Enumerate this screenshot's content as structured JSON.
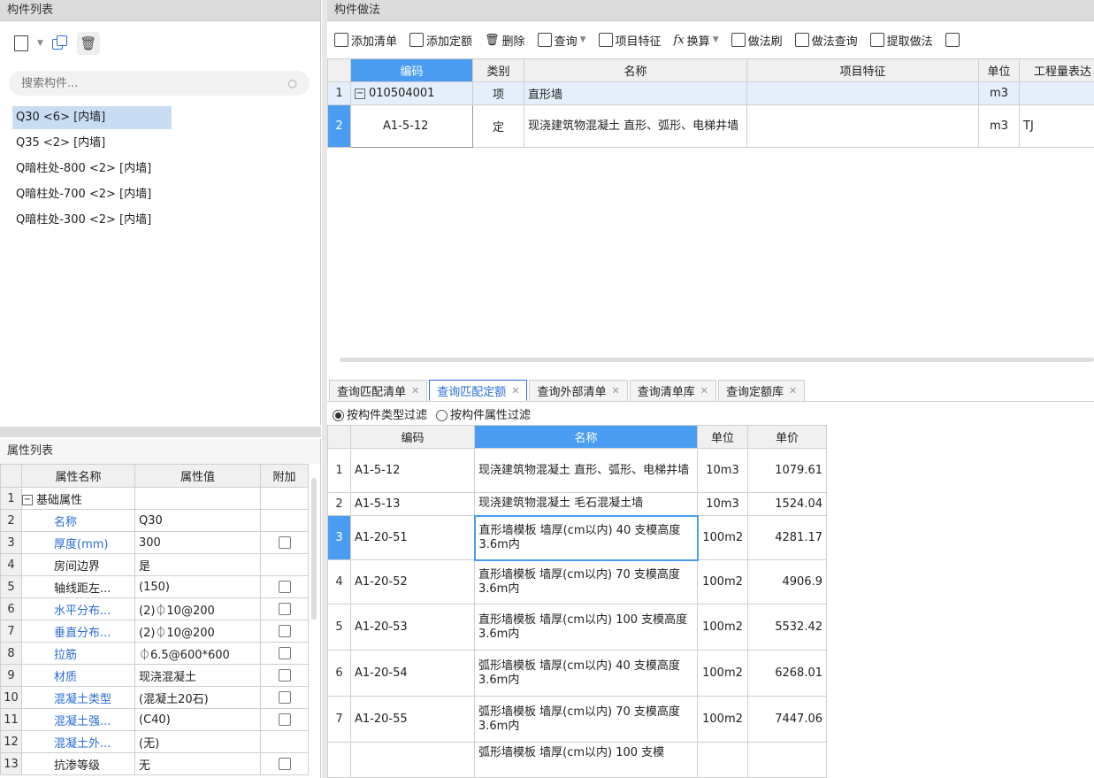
{
  "left_panel": {
    "title": "构件列表",
    "search_placeholder": "搜索构件...",
    "items": [
      {
        "label": "Q30 <6> [内墙]"
      },
      {
        "label": "Q35 <2> [内墙]"
      },
      {
        "label": "Q暗柱处-800 <2> [内墙]"
      },
      {
        "label": "Q暗柱处-700 <2> [内墙]"
      },
      {
        "label": "Q暗柱处-300 <2> [内墙]"
      }
    ]
  },
  "props_panel": {
    "title": "属性列表",
    "headers": {
      "name": "属性名称",
      "value": "属性值",
      "extra": "附加"
    },
    "rows": [
      {
        "n": "1",
        "name": "基础属性",
        "value": "",
        "cb": false,
        "blue": false,
        "group": true
      },
      {
        "n": "2",
        "name": "名称",
        "value": "Q30",
        "cb": false,
        "blue": true
      },
      {
        "n": "3",
        "name": "厚度(mm)",
        "value": "300",
        "cb": true,
        "blue": true
      },
      {
        "n": "4",
        "name": "房间边界",
        "value": "是",
        "cb": false,
        "blue": false
      },
      {
        "n": "5",
        "name": "轴线距左...",
        "value": "(150)",
        "cb": true,
        "blue": false
      },
      {
        "n": "6",
        "name": "水平分布...",
        "value": "(2)⏀10@200",
        "cb": true,
        "blue": true
      },
      {
        "n": "7",
        "name": "垂直分布...",
        "value": "(2)⏀10@200",
        "cb": true,
        "blue": true
      },
      {
        "n": "8",
        "name": "拉筋",
        "value": "⏀6.5@600*600",
        "cb": true,
        "blue": true
      },
      {
        "n": "9",
        "name": "材质",
        "value": "现浇混凝土",
        "cb": true,
        "blue": true
      },
      {
        "n": "10",
        "name": "混凝土类型",
        "value": "(混凝土20石)",
        "cb": true,
        "blue": true
      },
      {
        "n": "11",
        "name": "混凝土强...",
        "value": "(C40)",
        "cb": true,
        "blue": true
      },
      {
        "n": "12",
        "name": "混凝土外...",
        "value": "(无)",
        "cb": false,
        "blue": true
      },
      {
        "n": "13",
        "name": "抗渗等级",
        "value": "无",
        "cb": true,
        "blue": false
      }
    ]
  },
  "method_panel": {
    "title": "构件做法",
    "toolbar": [
      "添加清单",
      "添加定额",
      "删除",
      "查询",
      "项目特征",
      "换算",
      "做法刷",
      "做法查询",
      "提取做法"
    ],
    "headers": [
      "编码",
      "类别",
      "名称",
      "项目特征",
      "单位",
      "工程量表达"
    ],
    "rows": [
      {
        "n": "1",
        "code": "010504001",
        "type": "项",
        "name": "直形墙",
        "feature": "",
        "unit": "m3",
        "expr": ""
      },
      {
        "n": "2",
        "code": "A1-5-12",
        "type": "定",
        "name": "现浇建筑物混凝土 直形、弧形、电梯井墙",
        "feature": "",
        "unit": "m3",
        "expr": "TJ"
      }
    ]
  },
  "query_panel": {
    "tabs": [
      "查询匹配清单",
      "查询匹配定额",
      "查询外部清单",
      "查询清单库",
      "查询定额库"
    ],
    "filters": [
      "按构件类型过滤",
      "按构件属性过滤"
    ],
    "headers": [
      "编码",
      "名称",
      "单位",
      "单价"
    ],
    "rows": [
      {
        "n": "1",
        "code": "A1-5-12",
        "name": "现浇建筑物混凝土 直形、弧形、电梯井墙",
        "unit": "10m3",
        "price": "1079.61"
      },
      {
        "n": "2",
        "code": "A1-5-13",
        "name": "现浇建筑物混凝土 毛石混凝土墙",
        "unit": "10m3",
        "price": "1524.04"
      },
      {
        "n": "3",
        "code": "A1-20-51",
        "name": "直形墙模板 墙厚(cm以内) 40 支模高度3.6m内",
        "unit": "100m2",
        "price": "4281.17"
      },
      {
        "n": "4",
        "code": "A1-20-52",
        "name": "直形墙模板 墙厚(cm以内) 70 支模高度3.6m内",
        "unit": "100m2",
        "price": "4906.9"
      },
      {
        "n": "5",
        "code": "A1-20-53",
        "name": "直形墙模板 墙厚(cm以内) 100 支模高度3.6m内",
        "unit": "100m2",
        "price": "5532.42"
      },
      {
        "n": "6",
        "code": "A1-20-54",
        "name": "弧形墙模板 墙厚(cm以内) 40 支模高度3.6m内",
        "unit": "100m2",
        "price": "6268.01"
      },
      {
        "n": "7",
        "code": "A1-20-55",
        "name": "弧形墙模板 墙厚(cm以内) 70 支模高度3.6m内",
        "unit": "100m2",
        "price": "7447.06"
      },
      {
        "n": "",
        "code": "",
        "name": "弧形墙模板 墙厚(cm以内) 100 支模",
        "unit": "",
        "price": ""
      }
    ]
  }
}
